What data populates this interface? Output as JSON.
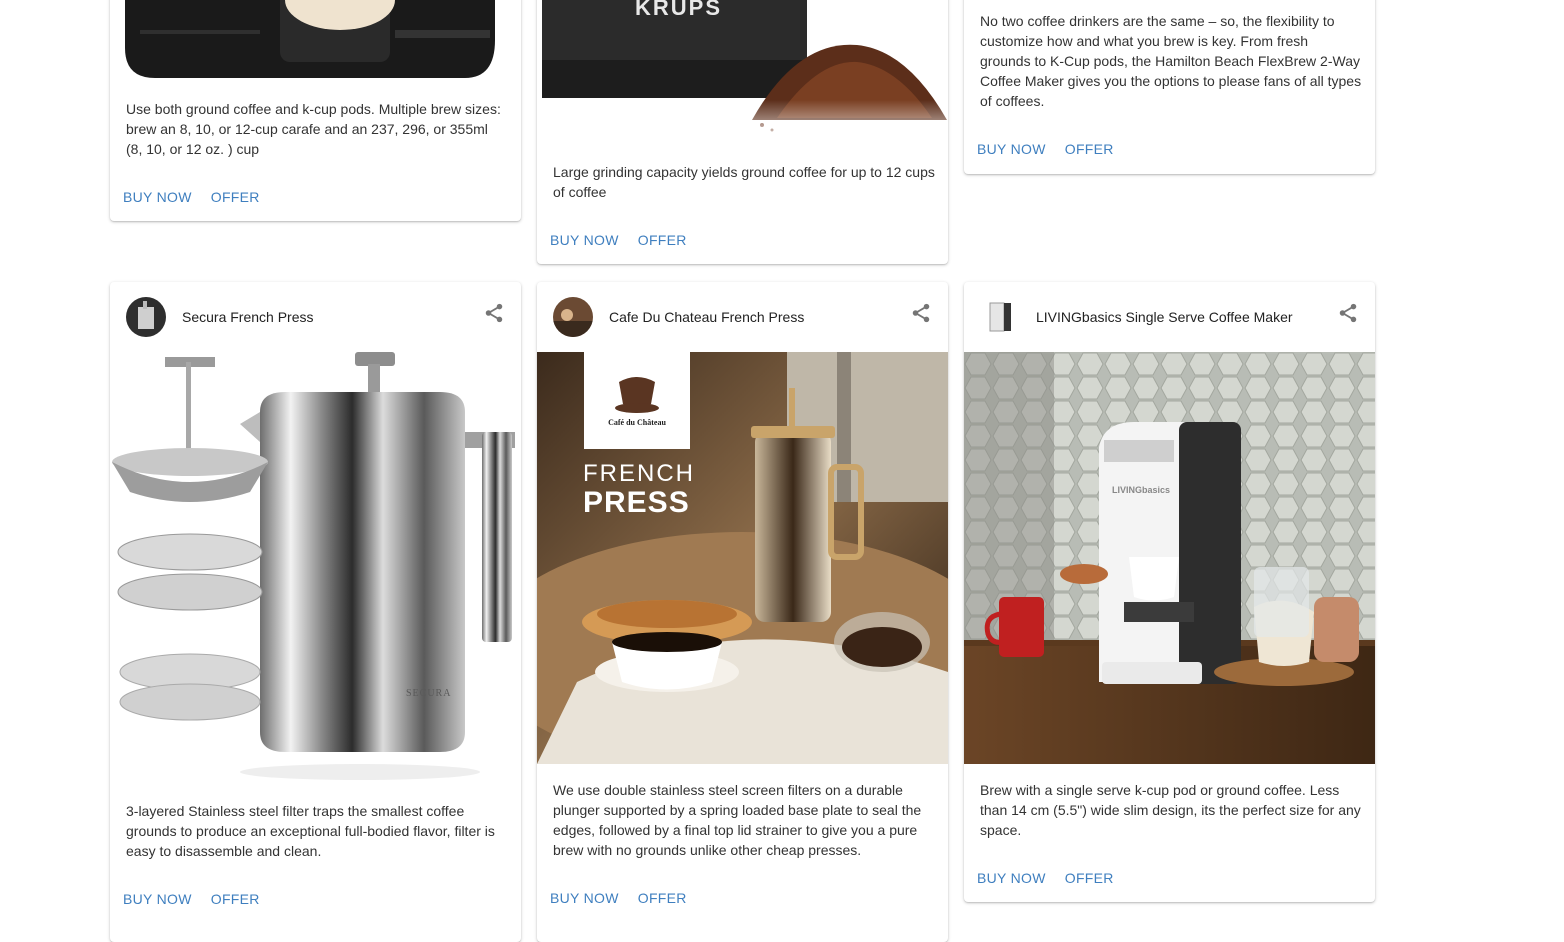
{
  "colors": {
    "accent": "#3f7fbf"
  },
  "top_row": [
    {
      "description": "Use both ground coffee and k-cup pods. Multiple brew sizes: brew an 8, 10, or 12-cup carafe and an 237, 296, or 355ml (8, 10, or 12 oz. ) cup",
      "buy_label": "BUY NOW",
      "offer_label": "OFFER"
    },
    {
      "image_brand_text": "KRUPS",
      "description": "Large grinding capacity yields ground coffee for up to 12 cups of coffee",
      "buy_label": "BUY NOW",
      "offer_label": "OFFER"
    },
    {
      "description": "No two coffee drinkers are the same – so, the flexibility to customize how and what you brew is key. From fresh grounds to K-Cup pods, the Hamilton Beach FlexBrew 2-Way Coffee Maker gives you the options to please fans of all types of coffees.",
      "buy_label": "BUY NOW",
      "offer_label": "OFFER"
    }
  ],
  "bottom_row": [
    {
      "title": "Secura French Press",
      "avatar_icon": "french-press-thumbnail",
      "share_icon": "share-icon",
      "image_brand_text": "SECURA",
      "description": "3-layered Stainless steel filter traps the smallest coffee grounds to produce an exceptional full-bodied flavor, filter is easy to disassemble and clean.",
      "buy_label": "BUY NOW",
      "offer_label": "OFFER"
    },
    {
      "title": "Cafe Du Chateau French Press",
      "avatar_icon": "cafe-thumbnail",
      "share_icon": "share-icon",
      "image_logo_text": "Café du Château",
      "image_headline_1": "FRENCH",
      "image_headline_2": "PRESS",
      "description": "We use double stainless steel screen filters on a durable plunger supported by a spring loaded base plate to seal the edges, followed by a final top lid strainer to give you a pure brew with no grounds unlike other cheap presses.",
      "buy_label": "BUY NOW",
      "offer_label": "OFFER"
    },
    {
      "title": "LIVINGbasics Single Serve Coffee Maker",
      "avatar_icon": "coffee-maker-thumbnail",
      "share_icon": "share-icon",
      "image_brand_text": "LIVINGbasics",
      "description": "Brew with a single serve k-cup pod or ground coffee. Less than 14 cm (5.5\") wide slim design, its the perfect size for any space.",
      "buy_label": "BUY NOW",
      "offer_label": "OFFER"
    }
  ]
}
